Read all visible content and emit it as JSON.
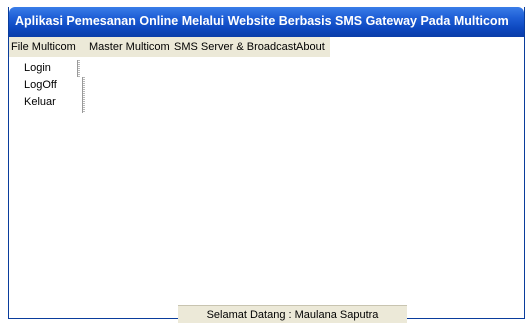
{
  "window": {
    "title": "Aplikasi Pemesanan Online Melalui Website Berbasis SMS Gateway Pada Multicom"
  },
  "menubar": {
    "items": [
      {
        "label": "File Multicom"
      },
      {
        "label": "Master Multicom"
      },
      {
        "label": "SMS Server & Broadcast"
      },
      {
        "label": "About"
      }
    ]
  },
  "dropdown": {
    "items": [
      {
        "label": "Login"
      },
      {
        "label": "LogOff"
      },
      {
        "label": "Keluar"
      }
    ]
  },
  "statusbar": {
    "text": "Selamat Datang : Maulana Saputra"
  },
  "colors": {
    "titlebar": "#0d48c0",
    "menubar": "#ece9d8",
    "title_text": "#ffffff"
  }
}
